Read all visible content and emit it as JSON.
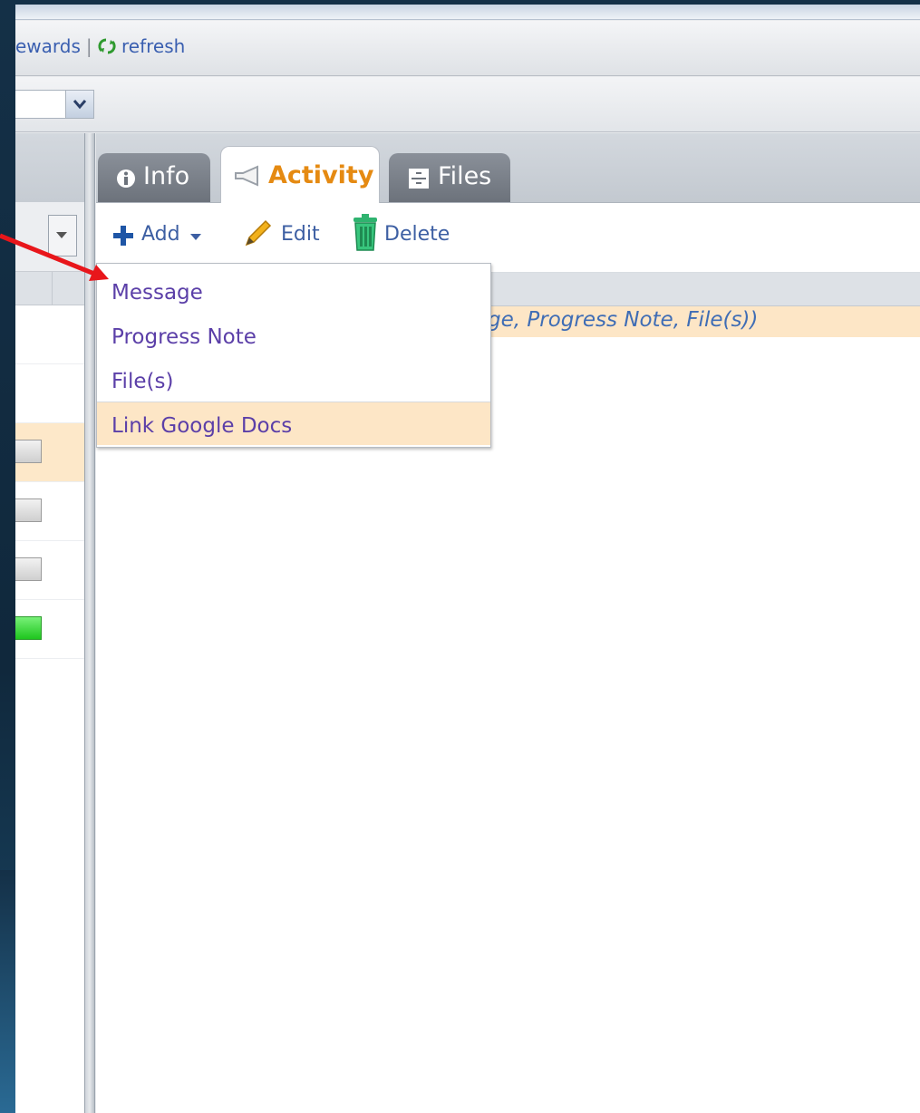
{
  "linkbar": {
    "rewards": "ewards",
    "separator": "|",
    "refresh": "refresh"
  },
  "tabs": {
    "info": "Info",
    "activity": "Activity",
    "files": "Files"
  },
  "toolbar": {
    "add": "Add",
    "edit": "Edit",
    "delete": "Delete"
  },
  "grid": {
    "hint": "ge, Progress Note, File(s))"
  },
  "menu": {
    "items": [
      "Message",
      "Progress Note",
      "File(s)",
      "Link Google Docs"
    ]
  },
  "colors": {
    "accent": "#e58a12",
    "link": "#3a5fb0",
    "highlight": "#fde6c6",
    "arrow": "#e8161b"
  }
}
